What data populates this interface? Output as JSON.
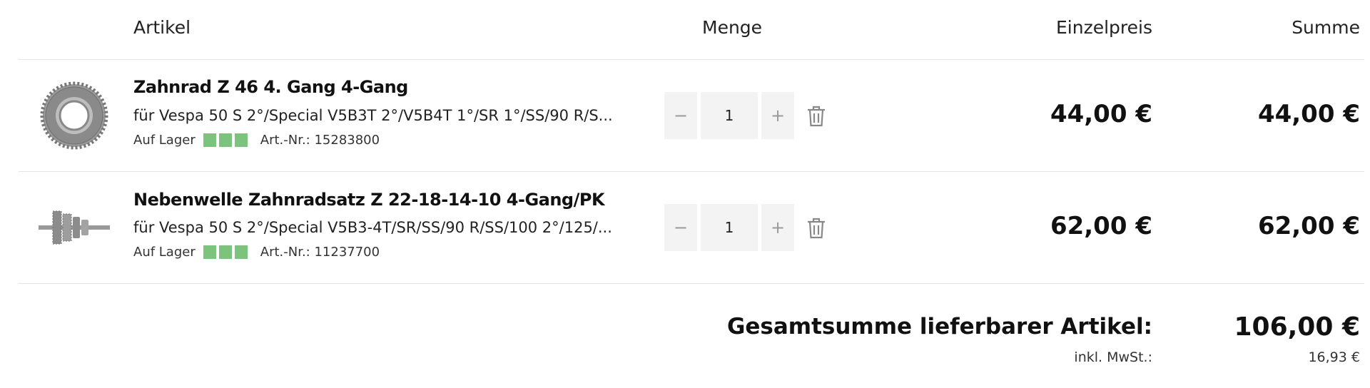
{
  "header": {
    "artikel": "Artikel",
    "menge": "Menge",
    "einzelpreis": "Einzelpreis",
    "summe": "Summe"
  },
  "items": [
    {
      "title": "Zahnrad Z 46 4. Gang 4-Gang",
      "subtitle": "für Vespa 50 S 2°/Special V5B3T 2°/V5B4T 1°/SR 1°/SS/90 R/S...",
      "stock_label": "Auf Lager",
      "stock_level": 3,
      "article_number": "Art.-Nr.: 15283800",
      "quantity": "1",
      "minus": "−",
      "plus": "+",
      "unit_price": "44,00 €",
      "total": "44,00 €",
      "thumb_icon": "gear-image"
    },
    {
      "title": "Nebenwelle Zahnradsatz Z 22-18-14-10 4-Gang/PK",
      "subtitle": "für Vespa 50 S 2°/Special V5B3-4T/SR/SS/90 R/SS/100 2°/125/...",
      "stock_label": "Auf Lager",
      "stock_level": 3,
      "article_number": "Art.-Nr.: 11237700",
      "quantity": "1",
      "minus": "−",
      "plus": "+",
      "unit_price": "62,00 €",
      "total": "62,00 €",
      "thumb_icon": "shaft-image"
    }
  ],
  "summary": {
    "total_label": "Gesamtsumme lieferbarer Artikel:",
    "total_value": "106,00 €",
    "vat_label": "inkl. MwSt.:",
    "vat_value": "16,93 €"
  },
  "colors": {
    "stock_green": "#7cc47e",
    "qty_bg": "#f3f3f3",
    "divider": "#e4e4e4"
  }
}
